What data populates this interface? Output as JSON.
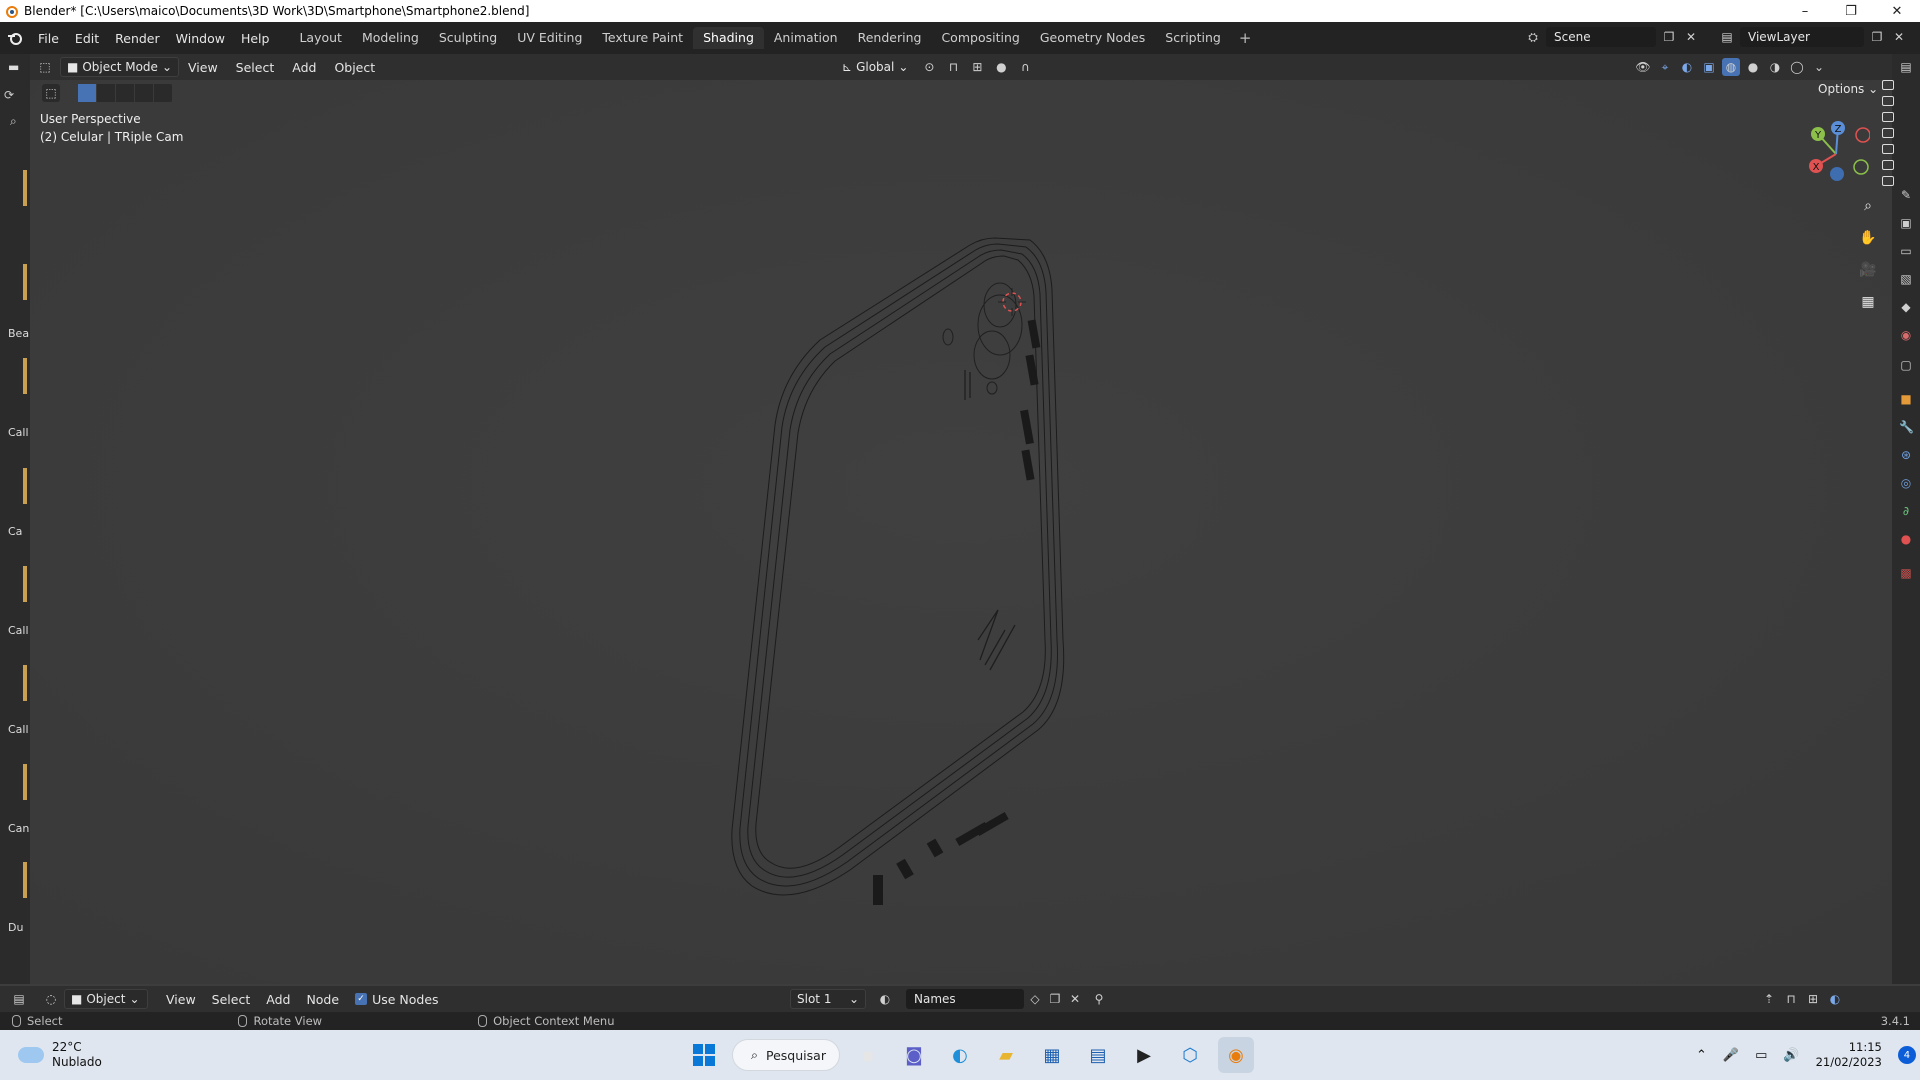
{
  "window": {
    "title": "Blender* [C:\\Users\\maico\\Documents\\3D Work\\3D\\Smartphone\\Smartphone2.blend]",
    "minimize": "–",
    "maximize": "❐",
    "close": "✕"
  },
  "menubar": {
    "menus": [
      "File",
      "Edit",
      "Render",
      "Window",
      "Help"
    ],
    "workspaces": [
      "Layout",
      "Modeling",
      "Sculpting",
      "UV Editing",
      "Texture Paint",
      "Shading",
      "Animation",
      "Rendering",
      "Compositing",
      "Geometry Nodes",
      "Scripting"
    ],
    "active_workspace": "Shading",
    "add_workspace": "+",
    "scene": "Scene",
    "view_layer": "ViewLayer"
  },
  "viewport_header": {
    "mode": "Object Mode",
    "menus": [
      "View",
      "Select",
      "Add",
      "Object"
    ],
    "transform_orientation": "Global",
    "options": "Options"
  },
  "viewport": {
    "perspective": "User Perspective",
    "active_object": "(2) Celular | TRiple Cam",
    "gizmo_axes": [
      "X",
      "Y",
      "Z"
    ]
  },
  "left_strip_labels": [
    "Bea",
    "Call",
    "Ca",
    "Call",
    "Call",
    "Can",
    "Du"
  ],
  "shader_header": {
    "object_mode": "Object",
    "menus": [
      "View",
      "Select",
      "Add",
      "Node"
    ],
    "use_nodes_label": "Use Nodes",
    "use_nodes_checked": true,
    "slot": "Slot 1",
    "material": "Names"
  },
  "statusbar": {
    "select": "Select",
    "rotate": "Rotate View",
    "context": "Object Context Menu",
    "version": "3.4.1"
  },
  "taskbar": {
    "temperature": "22°C",
    "weather": "Nublado",
    "search": "Pesquisar",
    "time": "11:15",
    "date": "21/02/2023",
    "notifications": "4"
  },
  "colors": {
    "accent": "#4772b3",
    "active_tab": "#303030",
    "viewport_bg": "#3d3d3d",
    "cursor_red": "#e05252"
  }
}
